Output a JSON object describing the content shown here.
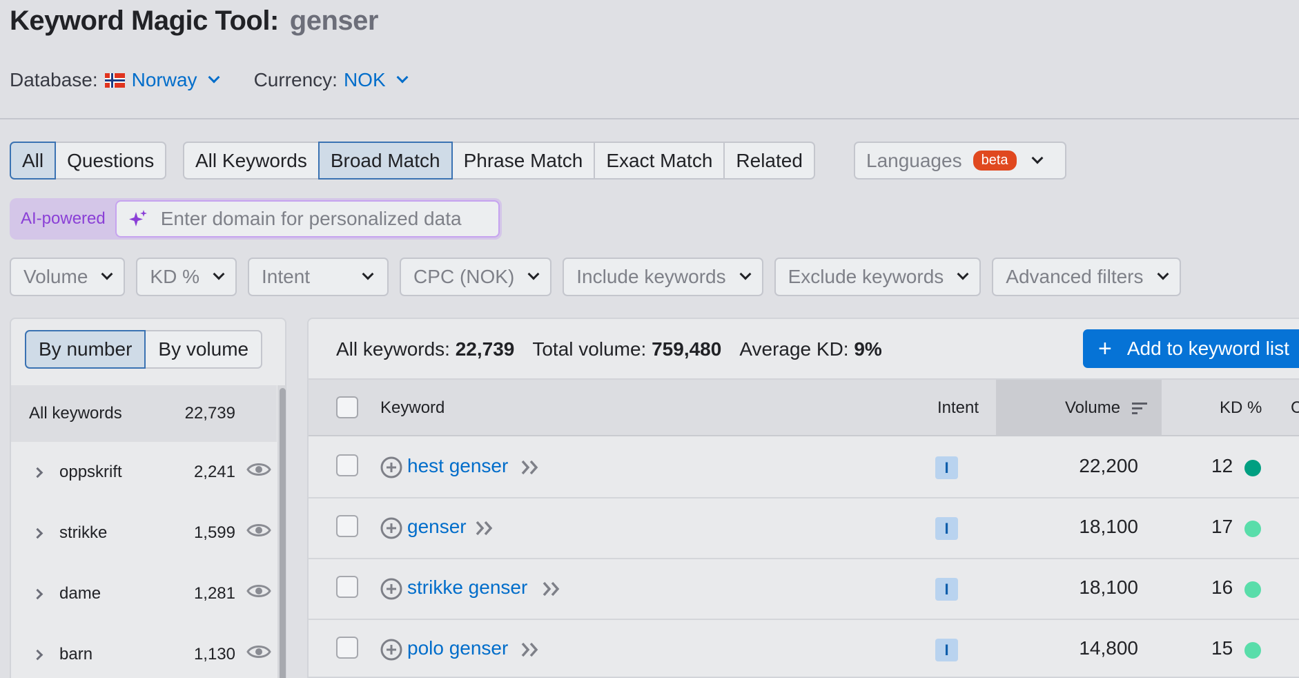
{
  "header": {
    "title": "Keyword Magic Tool:",
    "query": "genser"
  },
  "settings": {
    "database_label": "Database:",
    "database_value": "Norway",
    "currency_label": "Currency:",
    "currency_value": "NOK"
  },
  "question_tabs": [
    "All",
    "Questions"
  ],
  "match_tabs": [
    "All Keywords",
    "Broad Match",
    "Phrase Match",
    "Exact Match",
    "Related"
  ],
  "languages": {
    "label": "Languages",
    "badge": "beta"
  },
  "ai": {
    "label": "AI-powered",
    "placeholder": "Enter domain for personalized data"
  },
  "filters": [
    "Volume",
    "KD %",
    "Intent",
    "CPC (NOK)",
    "Include keywords",
    "Exclude keywords",
    "Advanced filters"
  ],
  "sidebar": {
    "toggle": [
      "By number",
      "By volume"
    ],
    "all_label": "All keywords",
    "all_count": "22,739",
    "groups": [
      {
        "name": "oppskrift",
        "count": "2,241"
      },
      {
        "name": "strikke",
        "count": "1,599"
      },
      {
        "name": "dame",
        "count": "1,281"
      },
      {
        "name": "barn",
        "count": "1,130"
      }
    ]
  },
  "summary": {
    "all_label": "All keywords:",
    "all_value": "22,739",
    "volume_label": "Total volume:",
    "volume_value": "759,480",
    "kd_label": "Average KD:",
    "kd_value": "9%",
    "add_button": "Add to keyword list"
  },
  "table": {
    "columns": {
      "keyword": "Keyword",
      "intent": "Intent",
      "volume": "Volume",
      "kd": "KD %",
      "next": "C"
    },
    "rows": [
      {
        "keyword": "hest genser",
        "intent": "I",
        "volume": "22,200",
        "kd": "12",
        "kd_color": "#009f81"
      },
      {
        "keyword": "genser",
        "intent": "I",
        "volume": "18,100",
        "kd": "17",
        "kd_color": "#59ddaa"
      },
      {
        "keyword": "strikke genser",
        "intent": "I",
        "volume": "18,100",
        "kd": "16",
        "kd_color": "#59ddaa"
      },
      {
        "keyword": "polo genser",
        "intent": "I",
        "volume": "14,800",
        "kd": "15",
        "kd_color": "#59ddaa"
      }
    ]
  },
  "colors": {
    "accent": "#006dca",
    "button": "#0673d6",
    "ai": "#8a3fd6",
    "beta": "#e0481f"
  }
}
